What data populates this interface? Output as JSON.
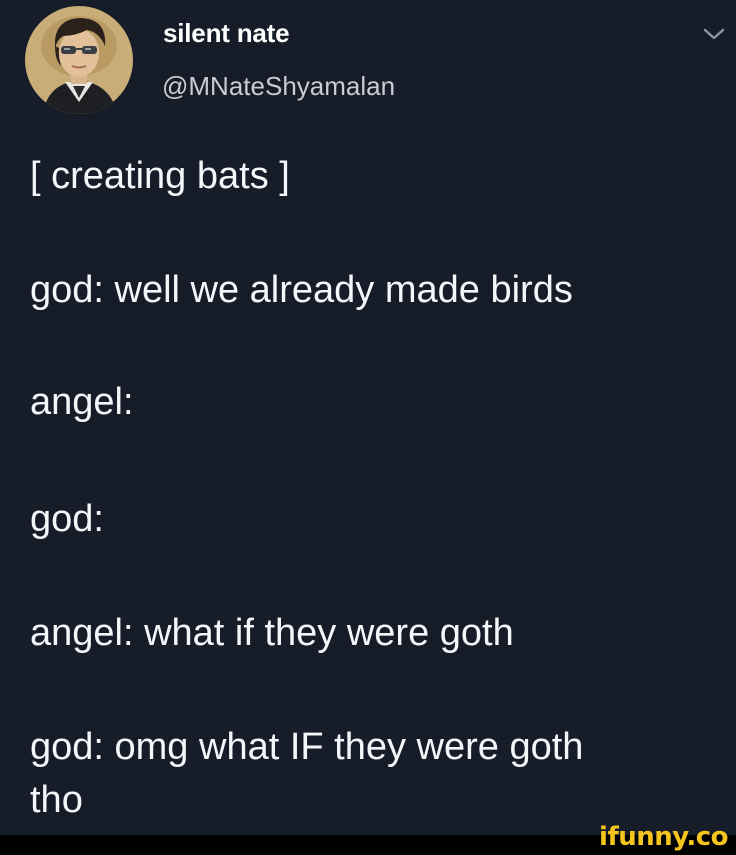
{
  "tweet": {
    "author": {
      "display_name": "silent nate",
      "handle": "@MNateShyamalan",
      "avatar_icon": "profile-avatar"
    },
    "menu_icon": "chevron-down-icon",
    "lines": [
      "[ creating bats ]",
      "god: well we already made birds",
      "angel:",
      "god:",
      "angel: what if they were goth",
      "god: omg what IF they were goth",
      "tho"
    ]
  },
  "watermark": {
    "text": "ifunny.co",
    "color": "#f5c51d"
  },
  "colors": {
    "background": "#161c28",
    "text": "#f4f6f9",
    "handle_text": "#c8ccd3"
  }
}
